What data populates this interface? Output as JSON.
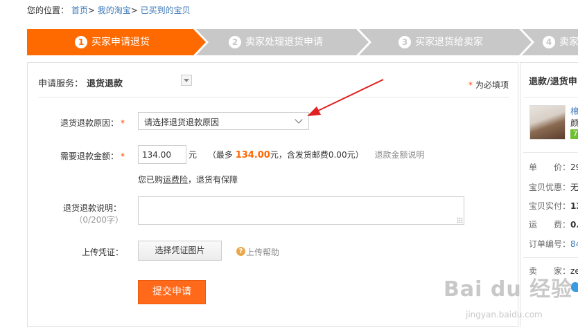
{
  "breadcrumb": {
    "prefix": "您的位置：",
    "items": [
      "首页",
      "我的淘宝",
      "已买到的宝贝"
    ],
    "separator": ">"
  },
  "steps": [
    {
      "num": "1",
      "label": "买家申请退货",
      "active": true
    },
    {
      "num": "2",
      "label": "卖家处理退货申请",
      "active": false
    },
    {
      "num": "3",
      "label": "买家退货给卖家",
      "active": false
    },
    {
      "num": "4",
      "label": "卖家",
      "active": false
    }
  ],
  "colors": {
    "step_active": "#ff6a00",
    "step_inactive": "#c8c8c8",
    "accent_orange": "#ff6600",
    "link_blue": "#3c78b8",
    "required_red": "#ff4400",
    "annotation_arrow": "#e02020"
  },
  "form": {
    "service_label": "申请服务：",
    "service_value": "退货退款",
    "required_star": "*",
    "required_note": "为必填项",
    "reason_label": "退货退款原因：",
    "reason_placeholder": "请选择退货退款原因",
    "amount_label": "需要退款金额：",
    "amount_value": "134.00",
    "amount_unit": "元",
    "amount_max_prefix": "（最多",
    "amount_max_value": "134.00",
    "amount_max_suffix": "元，含发货邮费0.00元）",
    "amount_explain": "退款金额说明",
    "insurance_prefix": "您已购",
    "insurance_link": "运费险",
    "insurance_suffix": "，退货有保障",
    "desc_label": "退货退款说明：",
    "desc_counter": "（0/200字）",
    "upload_label": "上传凭证：",
    "upload_button": "选择凭证图片",
    "help_icon_glyph": "?",
    "help_text": "上传帮助",
    "submit_button": "提交申请"
  },
  "right_panel": {
    "title": "退款/退货申",
    "product_name": "棉",
    "product_color": "颜",
    "product_badge": "7",
    "rows": [
      {
        "label": "单　　价：",
        "value": "29"
      },
      {
        "label": "宝贝优惠：",
        "value": "无"
      },
      {
        "label": "宝贝实付：",
        "value": "13"
      },
      {
        "label": "运　　费：",
        "value": "0."
      },
      {
        "label": "订单编号：",
        "value": "84"
      },
      {
        "label": "卖　　家：",
        "value": "ze"
      }
    ]
  },
  "watermark": {
    "logo": "Bai du 经验",
    "url": "jingyan.baidu.com"
  }
}
